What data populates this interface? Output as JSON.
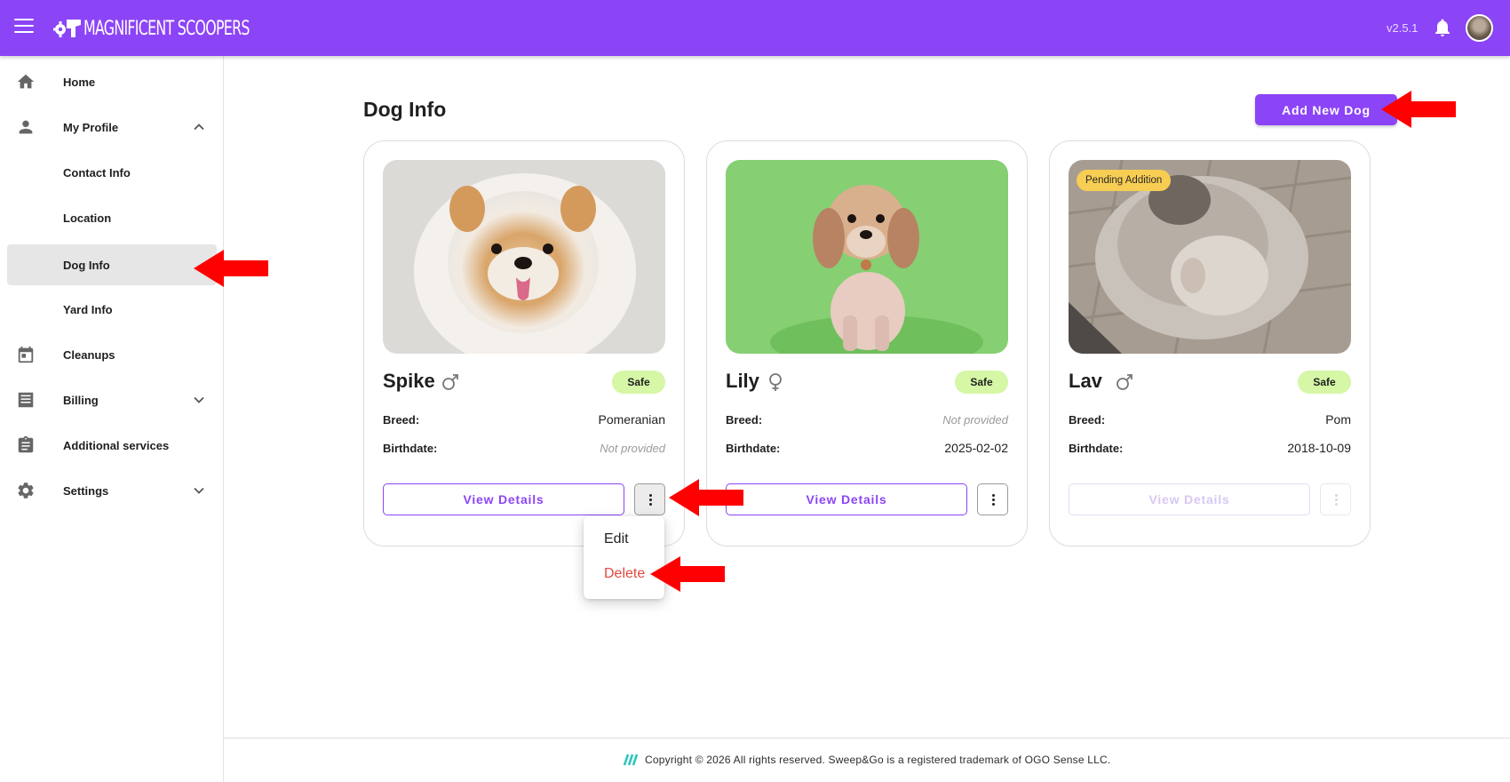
{
  "header": {
    "brand": "MAGNIFICENT SCOOPERS",
    "version": "v2.5.1"
  },
  "sidebar": {
    "items": [
      {
        "label": "Home",
        "icon": "home-icon"
      },
      {
        "label": "My Profile",
        "icon": "person-icon",
        "expanded": true
      },
      {
        "label": "Contact Info"
      },
      {
        "label": "Location"
      },
      {
        "label": "Dog Info",
        "active": true
      },
      {
        "label": "Yard Info"
      },
      {
        "label": "Cleanups",
        "icon": "calendar-icon"
      },
      {
        "label": "Billing",
        "icon": "receipt-icon",
        "expanded": false
      },
      {
        "label": "Additional services",
        "icon": "clipboard-icon"
      },
      {
        "label": "Settings",
        "icon": "gear-icon",
        "expanded": false
      }
    ]
  },
  "main": {
    "title": "Dog Info",
    "add_button": "Add New Dog",
    "breed_label": "Breed:",
    "birthdate_label": "Birthdate:",
    "view_details_label": "View Details",
    "dogs": [
      {
        "name": "Spike",
        "gender": "male",
        "status": "Safe",
        "breed": "Pomeranian",
        "birthdate": "Not provided",
        "pending": ""
      },
      {
        "name": "Lily",
        "gender": "female",
        "status": "Safe",
        "breed": "Not provided",
        "birthdate": "2025-02-02",
        "pending": ""
      },
      {
        "name": "Lav",
        "gender": "male",
        "status": "Safe",
        "breed": "Pom",
        "birthdate": "2018-10-09",
        "pending": "Pending Addition"
      }
    ],
    "menu": {
      "edit": "Edit",
      "delete": "Delete"
    }
  },
  "footer": {
    "text": "Copyright © 2026 All rights reserved. Sweep&Go is a registered trademark of OGO Sense LLC."
  },
  "colors": {
    "brand": "#8c44f7",
    "safe_badge": "#d5f7a6",
    "pending_badge": "#f7cd53",
    "delete": "#e0473f",
    "annotation_arrow": "#ff0000"
  }
}
